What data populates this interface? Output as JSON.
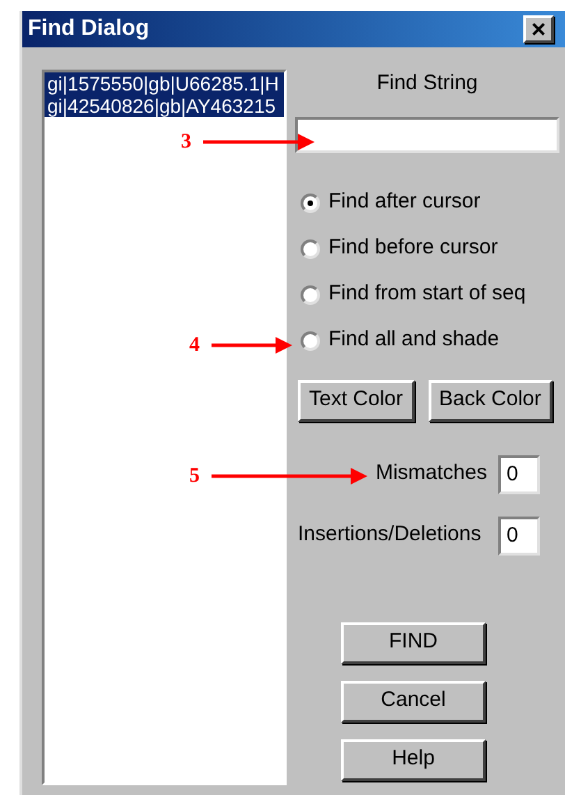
{
  "window": {
    "title": "Find Dialog",
    "close": "×"
  },
  "sequence_list": {
    "items": [
      {
        "label": "gi|1575550|gb|U66285.1|H",
        "selected": true
      },
      {
        "label": "gi|42540826|gb|AY463215",
        "selected": true
      }
    ]
  },
  "find_string": {
    "label": "Find String"
  },
  "search_modes": [
    {
      "label": "Find after cursor",
      "selected": true
    },
    {
      "label": "Find before cursor",
      "selected": false
    },
    {
      "label": "Find from start of seq",
      "selected": false
    },
    {
      "label": "Find all and shade",
      "selected": false
    }
  ],
  "color_buttons": [
    "Text Color",
    "Back Color"
  ],
  "mismatches": {
    "label": "Mismatches",
    "value": "0"
  },
  "indels": {
    "label": "Insertions/Deletions",
    "value": "0"
  },
  "actions": [
    "FIND",
    "Cancel",
    "Help"
  ],
  "annotations": [
    {
      "label": "3"
    },
    {
      "label": "4"
    },
    {
      "label": "5"
    }
  ]
}
